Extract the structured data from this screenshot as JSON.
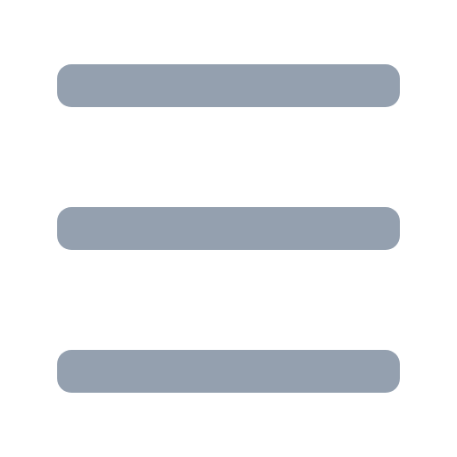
{
  "icon": {
    "name": "hamburger-menu-icon",
    "color": "#94a0af",
    "background": "#ffffff"
  }
}
